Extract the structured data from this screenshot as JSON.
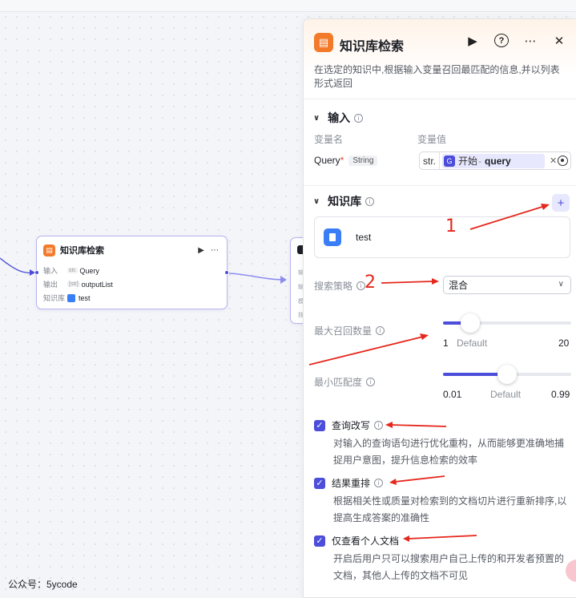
{
  "canvas": {
    "watermark": "公众号：5ycode",
    "node": {
      "title": "知识库检索",
      "logo_glyph": "▤",
      "rows": [
        {
          "key": "输入",
          "tag": "str.",
          "value": "Query"
        },
        {
          "key": "输出",
          "tag": "[str]",
          "value": "outputList"
        },
        {
          "key": "知识库",
          "tag": "",
          "value": "test"
        }
      ]
    }
  },
  "panel": {
    "title": "知识库检索",
    "logo_glyph": "▤",
    "run_icon": "▶",
    "help_icon": "?",
    "more_icon": "⋯",
    "close_icon": "✕",
    "description": "在选定的知识中,根据输入变量召回最匹配的信息,并以列表形式返回",
    "input_section": {
      "title": "输入",
      "col_name": "变量名",
      "col_value": "变量值",
      "var_name": "Query",
      "required_mark": "*",
      "var_type": "String",
      "value_type": "str.",
      "ref_source": "开始",
      "ref_sep": "-",
      "ref_var": "query"
    },
    "kb_section": {
      "title": "知识库",
      "add_icon": "+",
      "kb_name": "test"
    },
    "strategy": {
      "label": "搜索策略",
      "value": "混合"
    },
    "max_recall": {
      "label": "最大召回数量",
      "min": "1",
      "default_label": "Default",
      "max": "20",
      "value_fraction": 0.21
    },
    "min_match": {
      "label": "最小匹配度",
      "min": "0.01",
      "default_label": "Default",
      "max": "0.99",
      "value_fraction": 0.5
    },
    "options": [
      {
        "label": "查询改写",
        "checked": true,
        "desc": "对输入的查询语句进行优化重构，从而能够更准确地捕捉用户意图，提升信息检索的效率"
      },
      {
        "label": "结果重排",
        "checked": true,
        "desc": "根据相关性或质量对检索到的文档切片进行重新排序,以提高生成答案的准确性"
      },
      {
        "label": "仅查看个人文档",
        "checked": true,
        "desc": "开启后用户只可以搜索用户自己上传的和开发者预置的文档，其他人上传的文档不可见"
      }
    ]
  },
  "annotations": {
    "num1": "1",
    "num2": "2",
    "color": "#e5271c"
  }
}
